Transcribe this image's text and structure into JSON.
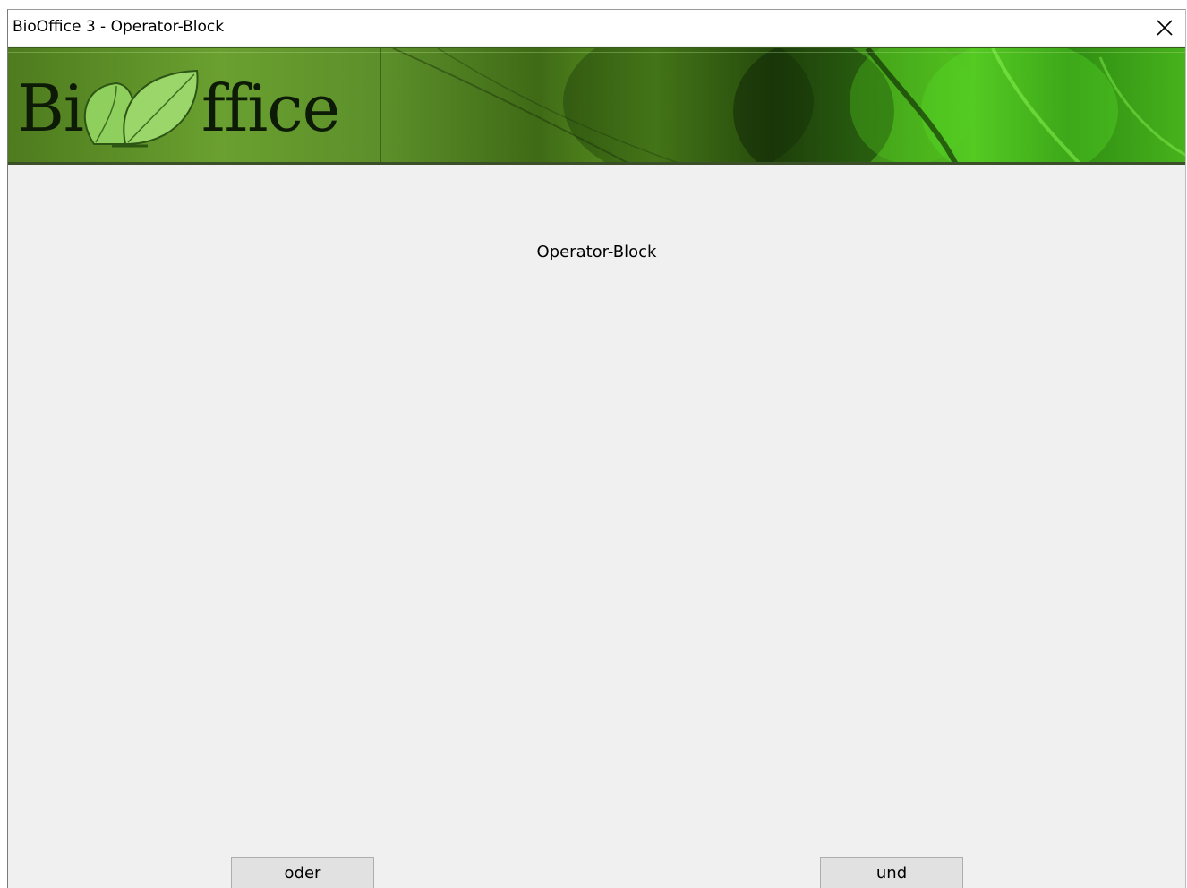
{
  "window": {
    "title": "BioOffice 3 - Operator-Block"
  },
  "banner": {
    "logo_prefix": "Bi",
    "logo_suffix": "ffice",
    "logo_icon": "leaf-icon"
  },
  "main": {
    "heading": "Operator-Block"
  },
  "buttons": {
    "oder_label": "oder",
    "und_label": "und"
  },
  "colors": {
    "banner_green": "#4e7b1e",
    "window_bg": "#f0f0f0",
    "button_bg": "#e1e1e1"
  }
}
